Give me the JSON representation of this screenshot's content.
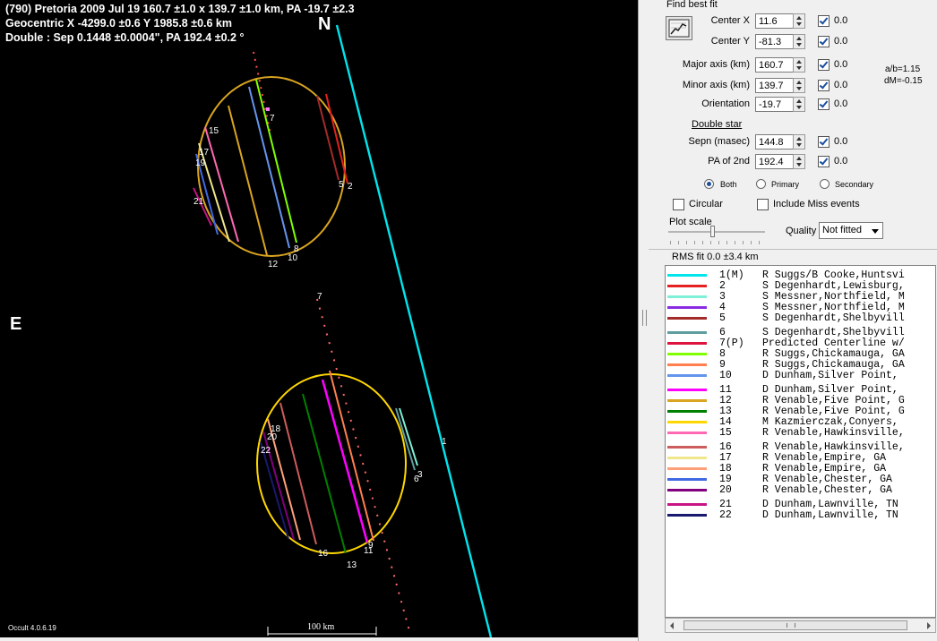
{
  "plot": {
    "header_lines": [
      "(790) Pretoria  2009 Jul 19  160.7 ±1.0 x 139.7 ±1.0 km,  PA -19.7 ±2.3",
      "Geocentric X  -4299.0 ±0.6  Y 1985.8 ±0.6 km",
      "Double : Sep  0.1448 ±0.0004\", PA 192.4 ±0.2 °"
    ],
    "north_label": "N",
    "east_label": "E",
    "version": "Occult 4.0.6.19",
    "scale_label": "100 km",
    "chord_labels_upper": [
      "2",
      "5",
      "7",
      "8",
      "10",
      "12",
      "15",
      "17",
      "19",
      "21"
    ],
    "chord_labels_lower": [
      "3",
      "6",
      "9",
      "11",
      "13",
      "16",
      "18",
      "20",
      "22"
    ],
    "observer_1_label": "1",
    "predicted_label": "7"
  },
  "panel": {
    "find_best_fit": "Find best fit",
    "fields": [
      {
        "label": "Center X",
        "value": "11.6",
        "checked": true,
        "cbval": "0.0"
      },
      {
        "label": "Center Y",
        "value": "-81.3",
        "checked": true,
        "cbval": "0.0"
      },
      {
        "label": "Major axis (km)",
        "value": "160.7",
        "checked": true,
        "cbval": "0.0"
      },
      {
        "label": "Minor axis (km)",
        "value": "139.7",
        "checked": true,
        "cbval": "0.0"
      },
      {
        "label": "Orientation",
        "value": "-19.7",
        "checked": true,
        "cbval": "0.0"
      },
      {
        "label": "Sepn (masec)",
        "value": "144.8",
        "checked": true,
        "cbval": "0.0"
      },
      {
        "label": "PA of 2nd",
        "value": "192.4",
        "checked": true,
        "cbval": "0.0"
      }
    ],
    "ratio_ab": "a/b=1.15",
    "ratio_dm": "dM=-0.15",
    "double_star": "Double star",
    "radio_both": "Both",
    "radio_primary": "Primary",
    "radio_secondary": "Secondary",
    "circular": "Circular",
    "include_miss": "Include Miss events",
    "plot_scale": "Plot scale",
    "quality_label": "Quality",
    "quality_value": "Not fitted",
    "rms_fit": "RMS fit 0.0 ±3.4 km"
  },
  "observers": [
    {
      "num": "1(M)",
      "name": "R Suggs/B Cooke,Huntsvi",
      "color": "#00e5ee"
    },
    {
      "num": "2",
      "name": "S Degenhardt,Lewisburg,",
      "color": "#e52020"
    },
    {
      "num": "3",
      "name": "S Messner,Northfield, M",
      "color": "#7ff0d8"
    },
    {
      "num": "4",
      "name": "S Messner,Northfield, M",
      "color": "#8a2be2"
    },
    {
      "num": "5",
      "name": "S Degenhardt,Shelbyvill",
      "color": "#a52a2a"
    },
    {
      "num": "6",
      "name": "S Degenhardt,Shelbyvill",
      "color": "#5f9ea0"
    },
    {
      "num": "7(P)",
      "name": "Predicted Centerline w/",
      "color": "#dc143c"
    },
    {
      "num": "8",
      "name": "R Suggs,Chickamauga, GA",
      "color": "#7fff00"
    },
    {
      "num": "9",
      "name": "R Suggs,Chickamauga, GA",
      "color": "#ff7f50"
    },
    {
      "num": "10",
      "name": "D Dunham,Silver Point,",
      "color": "#6495ed"
    },
    {
      "num": "11",
      "name": "D Dunham,Silver Point,",
      "color": "#ff00ff"
    },
    {
      "num": "12",
      "name": "R Venable,Five Point, G",
      "color": "#daa520"
    },
    {
      "num": "13",
      "name": "R Venable,Five Point, G",
      "color": "#008000"
    },
    {
      "num": "14",
      "name": "M Kazmierczak,Conyers,",
      "color": "#ffd700"
    },
    {
      "num": "15",
      "name": "R Venable,Hawkinsville,",
      "color": "#ff69b4"
    },
    {
      "num": "16",
      "name": "R Venable,Hawkinsville,",
      "color": "#cd5c5c"
    },
    {
      "num": "17",
      "name": "R Venable,Empire, GA",
      "color": "#f0e68c"
    },
    {
      "num": "18",
      "name": "R Venable,Empire, GA",
      "color": "#ffa07a"
    },
    {
      "num": "19",
      "name": "R Venable,Chester, GA",
      "color": "#4169e1"
    },
    {
      "num": "20",
      "name": "R Venable,Chester, GA",
      "color": "#800080"
    },
    {
      "num": "21",
      "name": "D Dunham,Lawnville, TN",
      "color": "#c71585"
    },
    {
      "num": "22",
      "name": "D Dunham,Lawnville, TN",
      "color": "#191970"
    }
  ]
}
